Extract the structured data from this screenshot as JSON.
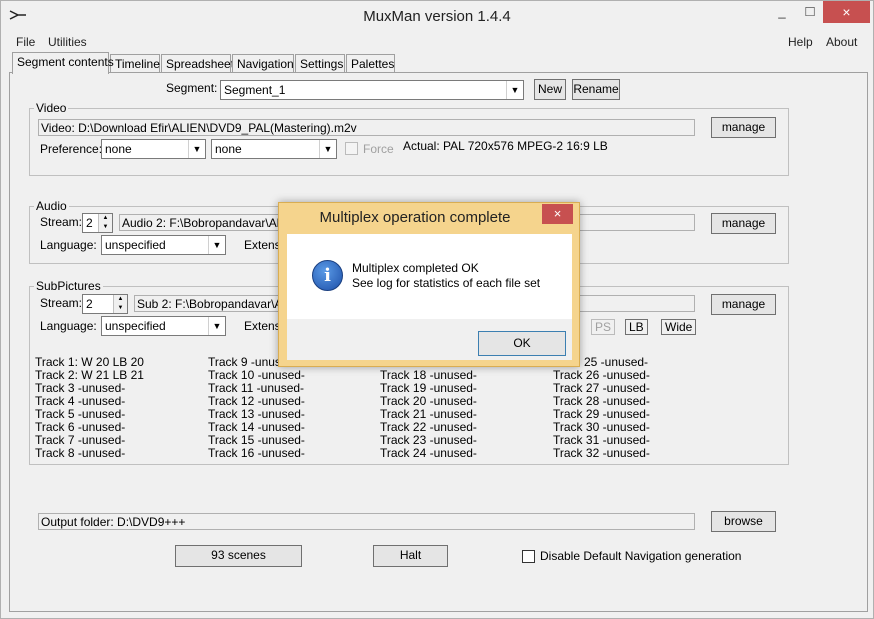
{
  "window": {
    "title": "MuxMan version 1.4.4",
    "minimize": "_",
    "maximize": "□",
    "close": "×"
  },
  "menu": {
    "file": "File",
    "utilities": "Utilities",
    "help": "Help",
    "about": "About"
  },
  "tabs": [
    "Segment contents",
    "Timeline",
    "Spreadsheet",
    "Navigation",
    "Settings",
    "Palettes"
  ],
  "segment": {
    "label": "Segment:",
    "value": "Segment_1",
    "new_button": "New",
    "rename_button": "Rename"
  },
  "video": {
    "group_label": "Video",
    "file": "Video: D:\\Download Efir\\ALIEN\\DVD9_PAL(Mastering).m2v",
    "manage_button": "manage",
    "preference_label": "Preference:",
    "pref1": "none",
    "pref2": "none",
    "force_label": "Force",
    "actual": "Actual: PAL  720x576  MPEG-2  16:9 LB"
  },
  "audio": {
    "group_label": "Audio",
    "stream_label": "Stream:",
    "stream_value": "2",
    "file": "Audio 2: F:\\Bobropandavar\\Alien",
    "manage_button": "manage",
    "language_label": "Language:",
    "language_value": "unspecified",
    "extension_label": "Extensi"
  },
  "subpictures": {
    "group_label": "SubPictures",
    "stream_label": "Stream:",
    "stream_value": "2",
    "file": "Sub 2: F:\\Bobropandavar\\Alien",
    "manage_button": "manage",
    "language_label": "Language:",
    "language_value": "unspecified",
    "extension_label": "Extensi",
    "ps_label": "PS",
    "lb_label": "LB",
    "wide_label": "Wide",
    "tracks_col1": [
      "Track 1:  W 20  LB 20",
      "Track 2:  W 21  LB 21",
      "Track 3  -unused-",
      "Track 4  -unused-",
      "Track 5  -unused-",
      "Track 6  -unused-",
      "Track 7  -unused-",
      "Track 8  -unused-"
    ],
    "tracks_col2": [
      "Track 9  -unused-",
      "Track 10  -unused-",
      "Track 11  -unused-",
      "Track 12  -unused-",
      "Track 13  -unused-",
      "Track 14  -unused-",
      "Track 15  -unused-",
      "Track 16  -unused-"
    ],
    "tracks_col3": [
      "",
      "Track 18  -unused-",
      "Track 19  -unused-",
      "Track 20  -unused-",
      "Track 21  -unused-",
      "Track 22  -unused-",
      "Track 23  -unused-",
      "Track 24  -unused-"
    ],
    "tracks_col4": [
      "25  -unused-",
      "Track 26  -unused-",
      "Track 27  -unused-",
      "Track 28  -unused-",
      "Track 29  -unused-",
      "Track 30  -unused-",
      "Track 31  -unused-",
      "Track 32  -unused-"
    ]
  },
  "output": {
    "folder": "Output folder: D:\\DVD9+++",
    "browse_button": "browse"
  },
  "bottom": {
    "scenes_button": "93 scenes",
    "halt_button": "Halt",
    "disable_nav_label": "Disable Default Navigation generation"
  },
  "dialog": {
    "title": "Multiplex operation complete",
    "close": "×",
    "icon": "i",
    "line1": "Multiplex completed OK",
    "line2": "See log for statistics of each file set",
    "ok_button": "OK"
  }
}
